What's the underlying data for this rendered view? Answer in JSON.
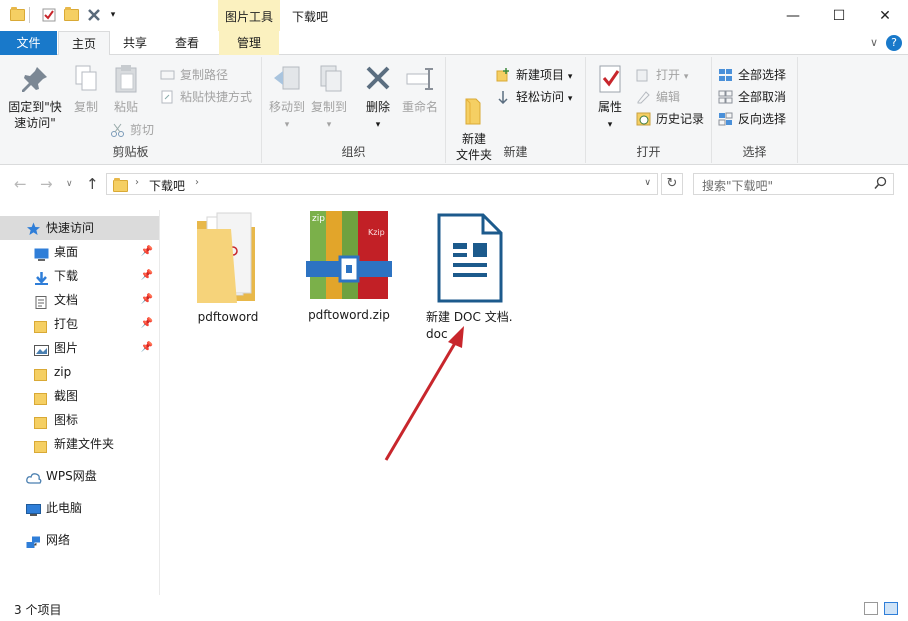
{
  "window": {
    "title": "下载吧",
    "context_tab_group": "图片工具",
    "controls": {
      "minimize": "—",
      "maximize": "☐",
      "close": "✕"
    }
  },
  "tabs": {
    "file": "文件",
    "home": "主页",
    "share": "共享",
    "view": "查看",
    "manage": "管理"
  },
  "ribbon": {
    "clipboard": {
      "label": "剪贴板",
      "pin": "固定到\"快速访问\"",
      "copy": "复制",
      "paste": "粘贴",
      "copy_path": "复制路径",
      "paste_shortcut": "粘贴快捷方式",
      "cut": "剪切"
    },
    "organize": {
      "label": "组织",
      "move_to": "移动到",
      "copy_to": "复制到",
      "delete": "删除",
      "rename": "重命名"
    },
    "new": {
      "label": "新建",
      "new_folder": "新建\n文件夹",
      "new_item": "新建项目",
      "easy_access": "轻松访问"
    },
    "open": {
      "label": "打开",
      "properties": "属性",
      "open": "打开",
      "edit": "编辑",
      "history": "历史记录"
    },
    "select": {
      "label": "选择",
      "select_all": "全部选择",
      "select_none": "全部取消",
      "invert": "反向选择"
    }
  },
  "address": {
    "crumb": "下载吧",
    "search_placeholder": "搜索\"下载吧\""
  },
  "sidebar": {
    "quick_access": "快速访问",
    "items": [
      {
        "label": "桌面",
        "pinned": true
      },
      {
        "label": "下载",
        "pinned": true
      },
      {
        "label": "文档",
        "pinned": true
      },
      {
        "label": "打包",
        "pinned": true
      },
      {
        "label": "图片",
        "pinned": true
      },
      {
        "label": "zip",
        "pinned": false
      },
      {
        "label": "截图",
        "pinned": false
      },
      {
        "label": "图标",
        "pinned": false
      },
      {
        "label": "新建文件夹",
        "pinned": false
      }
    ],
    "wps": "WPS网盘",
    "this_pc": "此电脑",
    "network": "网络"
  },
  "files": [
    {
      "name": "pdftoword",
      "type": "folder"
    },
    {
      "name": "pdftoword.zip",
      "type": "zip"
    },
    {
      "name": "新建 DOC 文档.doc",
      "type": "doc"
    }
  ],
  "status": {
    "count": "3 个项目"
  },
  "colors": {
    "accent": "#1979ca",
    "context": "#fbf1bf",
    "folder": "#f5cf63",
    "doc": "#1c5a8c",
    "arrow": "#c8262c"
  }
}
